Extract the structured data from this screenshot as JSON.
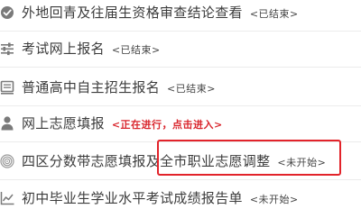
{
  "items": [
    {
      "label": "外地回青及往届生资格审查结论查看",
      "status": "<已结束>",
      "icon": "checkmark-icon",
      "state": "ended"
    },
    {
      "label": "考试网上报名",
      "status": "<已结束>",
      "icon": "sliders-icon",
      "state": "ended"
    },
    {
      "label": "普通高中自主招生报名",
      "status": "<已结束>",
      "icon": "document-icon",
      "state": "ended"
    },
    {
      "label": "网上志愿填报",
      "status": "<正在进行，点击进入>",
      "icon": "user-icon",
      "state": "active"
    },
    {
      "label": "四区分数带志愿填报及全市职业志愿调整",
      "status": "<未开始>",
      "icon": "target-icon",
      "state": "not-started"
    },
    {
      "label": "初中毕业生学业水平考试成绩报告单",
      "status": "<未开始>",
      "icon": "chart-line-icon",
      "state": "not-started"
    }
  ],
  "colors": {
    "active_status": "#d9252c",
    "highlight_border": "#e2232a",
    "label_text": "#3c3c3c",
    "icon": "#6f6f6f"
  }
}
